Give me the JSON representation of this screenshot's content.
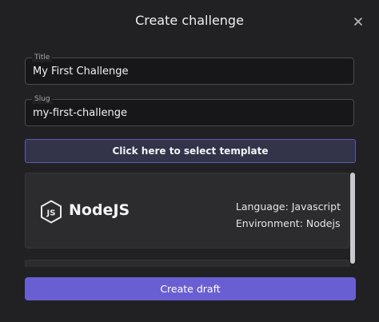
{
  "dialog": {
    "title": "Create challenge",
    "close_icon": "close-icon"
  },
  "fields": {
    "title": {
      "label": "Title",
      "value": "My First Challenge"
    },
    "slug": {
      "label": "Slug",
      "value": "my-first-challenge"
    }
  },
  "template_button": {
    "label": "Click here to select template"
  },
  "templates": [
    {
      "name": "NodeJS",
      "icon": "nodejs-icon",
      "language": "Language: Javascript",
      "environment": "Environment: Nodejs"
    }
  ],
  "actions": {
    "create_label": "Create draft"
  },
  "colors": {
    "background": "#212123",
    "accent": "#6a5fd2",
    "accent_border": "#5d58b6"
  }
}
